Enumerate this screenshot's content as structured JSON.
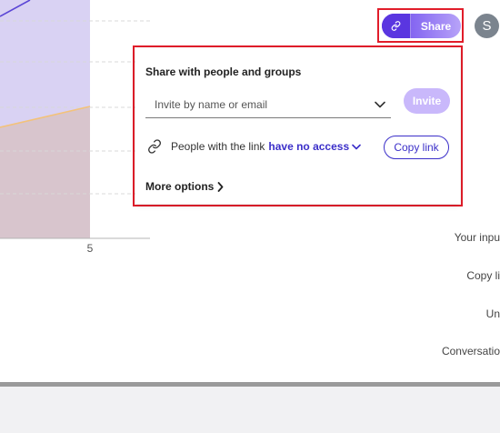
{
  "chart": {
    "x_tick_label": "5"
  },
  "header": {
    "share_label": "Share",
    "avatar_initial": "S",
    "link_icon": "link-icon"
  },
  "share_popup": {
    "title": "Share with people and groups",
    "invite_placeholder": "Invite by name or email",
    "invite_button": "Invite",
    "link_prefix": "People with the link",
    "access_level": "have no access",
    "copy_link_button": "Copy link",
    "more_options": "More options"
  },
  "side_list": {
    "items": [
      "Your inpu",
      "Copy li",
      "Un",
      "Conversatio"
    ]
  },
  "colors": {
    "accent": "#3b2fc9",
    "share_gradient_start": "#6a46e8",
    "share_gradient_end": "#b7a3f8",
    "invite_disabled": "#c9b8fb",
    "highlight": "#e11d2a"
  }
}
